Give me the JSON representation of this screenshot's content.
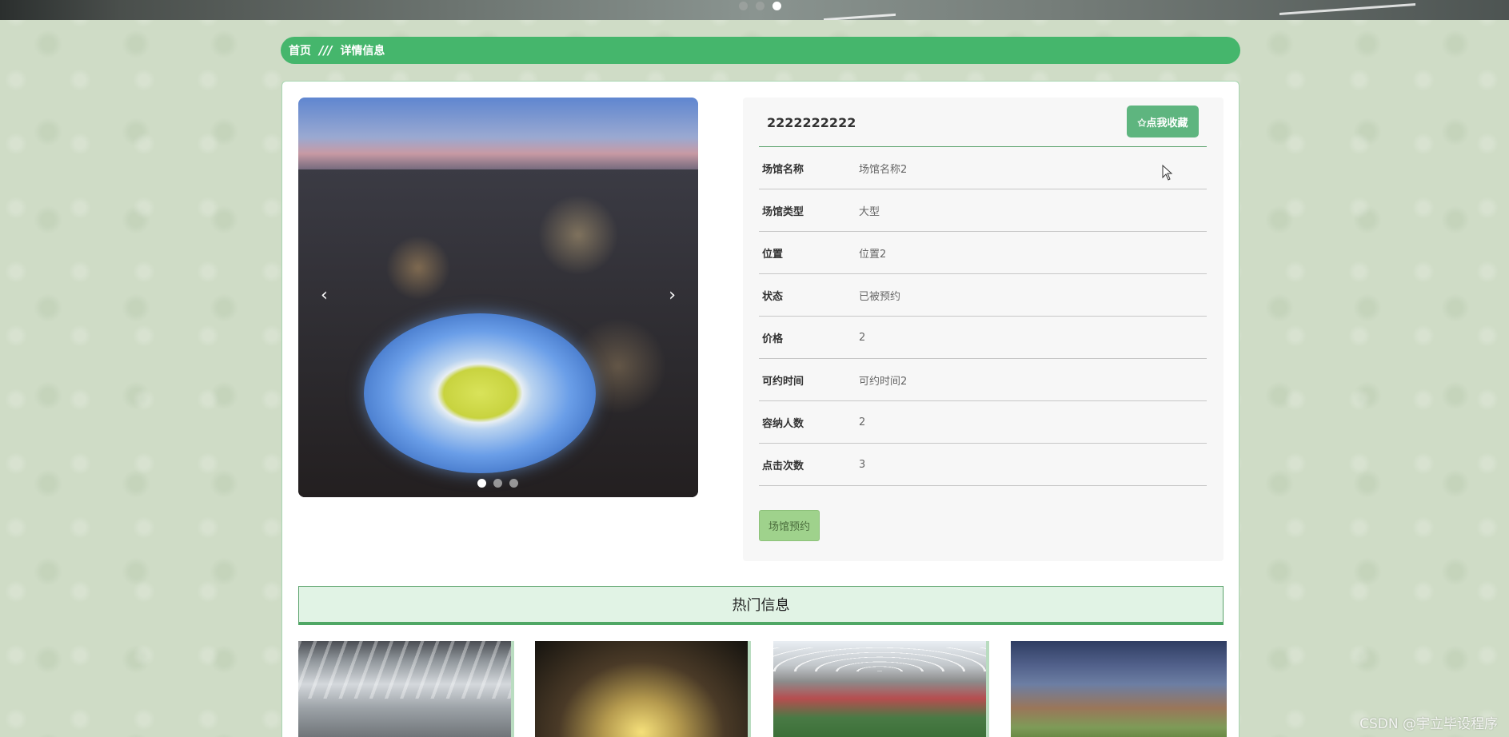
{
  "breadcrumb": {
    "home": "首页",
    "separator": "///",
    "current": "详情信息"
  },
  "detail": {
    "title": "2222222222",
    "favorite_button": "✩点我收藏",
    "fields": [
      {
        "label": "场馆名称",
        "value": "场馆名称2"
      },
      {
        "label": "场馆类型",
        "value": "大型"
      },
      {
        "label": "位置",
        "value": "位置2"
      },
      {
        "label": "状态",
        "value": "已被预约"
      },
      {
        "label": "价格",
        "value": "2"
      },
      {
        "label": "可约时间",
        "value": "可约时间2"
      },
      {
        "label": "容纳人数",
        "value": "2"
      },
      {
        "label": "点击次数",
        "value": "3"
      }
    ],
    "book_button": "场馆预约"
  },
  "carousel": {
    "prev": "‹",
    "next": "›",
    "slides": 3,
    "active_slide": 1
  },
  "banner": {
    "slides": 3,
    "active_slide": 3
  },
  "hot": {
    "title": "热门信息"
  },
  "watermark": "CSDN @宇立毕设程序",
  "colors": {
    "accent": "#45b66c",
    "favorite": "#5eb57f",
    "book": "#9fd28c",
    "hot_bg": "#e1f3e5"
  }
}
